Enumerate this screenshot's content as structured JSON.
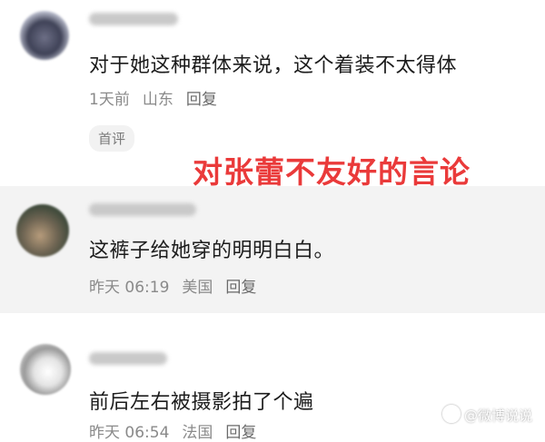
{
  "comments": [
    {
      "text": "对于她这种群体来说，这个着装不太得体",
      "time": "1天前",
      "location": "山东",
      "reply_label": "回复",
      "tag": "首评"
    },
    {
      "text": "这裤子给她穿的明明白白。",
      "time": "昨天 06:19",
      "location": "美国",
      "reply_label": "回复"
    },
    {
      "text": "前后左右被摄影拍了个遍",
      "time": "昨天 06:54",
      "location": "法国",
      "reply_label": "回复"
    }
  ],
  "annotation": "对张蕾不友好的言论",
  "watermark": "@微博说说",
  "colors": {
    "annotation": "#ea3a3a",
    "meta_text": "#8a8a8a",
    "highlight_bg": "#f3f3f3"
  }
}
